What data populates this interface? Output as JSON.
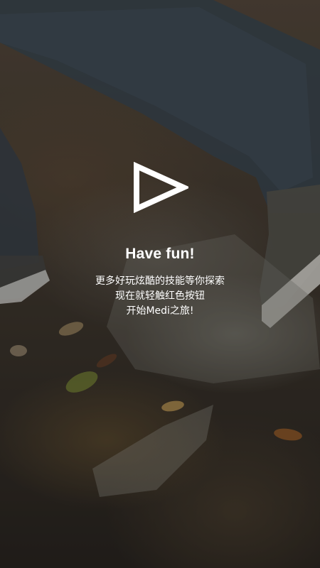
{
  "splash": {
    "icon": "play-triangle-icon",
    "title": "Have fun!",
    "lines": [
      "更多好玩炫酷的技能等你探索",
      "现在就轻触红色按钮",
      "开始Medi之旅!"
    ]
  },
  "colors": {
    "text": "#ffffff",
    "icon": "#ffffff"
  }
}
